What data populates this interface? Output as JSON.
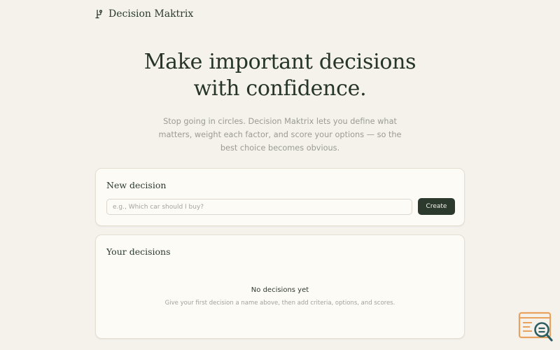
{
  "brand": {
    "name": "Decision Maktrix",
    "icon": "branch-icon"
  },
  "hero": {
    "title_line1": "Make important decisions",
    "title_line2": "with confidence.",
    "subtitle": "Stop going in circles. Decision Maktrix lets you define what matters, weight each factor, and score your options — so the best choice becomes obvious."
  },
  "new_decision": {
    "title": "New decision",
    "input_value": "",
    "input_placeholder": "e.g., Which car should I buy?",
    "create_label": "Create"
  },
  "your_decisions": {
    "title": "Your decisions",
    "empty_title": "No decisions yet",
    "empty_subtitle": "Give your first decision a name above, then add criteria, options, and scores."
  },
  "colors": {
    "background": "#f5f2ec",
    "card": "#fdfbf6",
    "accent": "#2b3a2d",
    "watermark": "#e9a25d"
  }
}
